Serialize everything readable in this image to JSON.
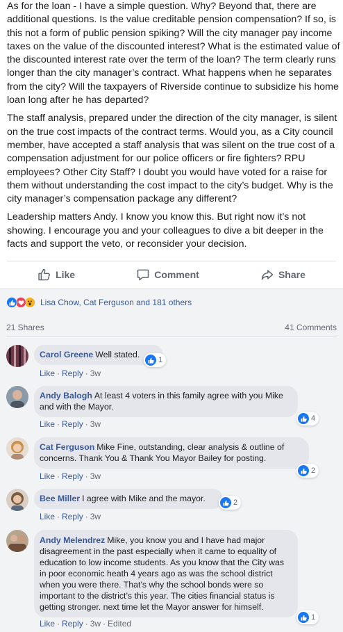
{
  "post": {
    "paragraphs": [
      "As for the loan - I have a simple question. Why? Beyond that, there are additional questions. Is the value creditable pension compensation? If so, is this not a form of public pension spiking? Will the city manager pay income taxes on the value of the discounted interest? What is the estimated value of the discounted interest rate over the term of the loan? The term clearly runs longer than the city manager’s contract. What happens when he separates from the city? Will the taxpayers of Riverside continue to subsidize his home loan long after he has departed?",
      "The staff analysis, prepared under the direction of the city manager, is silent on the true cost impacts of the contract terms. Would you, as a City council member, have accepted a staff analysis that was silent on the true cost of a compensation adjustment for our police officers or fire fighters? RPU employees? Other City Staff? I doubt you would have voted for a raise for them without understanding the cost impact to the city’s budget. Why is the city manager’s compensation package any different?",
      "Leadership matters Andy. I know you know this. But right now it’s not showing. I encourage you and your colleagues to dive a bit deeper in the facts and support the veto, or reconsider your decision."
    ]
  },
  "actions": {
    "like": "Like",
    "comment": "Comment",
    "share": "Share"
  },
  "reactions": {
    "names": "Lisa Chow, Cat Ferguson and 181 others",
    "icons": [
      "like-icon",
      "love-icon",
      "wow-icon"
    ]
  },
  "counts": {
    "shares": "21 Shares",
    "comments": "41 Comments"
  },
  "comments": [
    {
      "author": "Carol Greene",
      "text": "Well stated.",
      "like_label": "Like",
      "reply_label": "Reply",
      "time": "3w",
      "reactions": "1",
      "edited": ""
    },
    {
      "author": "Andy Balogh",
      "text": "At least 4 voters in this family agree with you Mike and with the Mayor.",
      "like_label": "Like",
      "reply_label": "Reply",
      "time": "3w",
      "reactions": "4",
      "edited": ""
    },
    {
      "author": "Cat Ferguson",
      "text": "Mike Fine, outstanding, clear analysis & outline of concerns. Thank You & Thank You Mayor Bailey for posting.",
      "like_label": "Like",
      "reply_label": "Reply",
      "time": "3w",
      "reactions": "2",
      "edited": ""
    },
    {
      "author": "Bee Miller",
      "text": "I agree with Mike and the mayor.",
      "like_label": "Like",
      "reply_label": "Reply",
      "time": "3w",
      "reactions": "2",
      "edited": ""
    },
    {
      "author": "Andy Melendrez",
      "text": "Mike, you know you and I have had major disagreement in the past especially when it came to equality of education to low income students. As you know that the City was in poor economic heath 4 years ago as was the school district when you were there. That’s why the school bonds were so important to the district’s this year. The cities financial status is getting stronger. next time let the Mayor answer for himself.",
      "like_label": "Like",
      "reply_label": "Reply",
      "time": "3w",
      "reactions": "1",
      "edited": "Edited"
    }
  ],
  "colors": {
    "link": "#385898",
    "like_blue": "#1877f2",
    "love_red": "#f33e58",
    "wow_yellow": "#f7b125",
    "bubble_bg": "#e4e6eb",
    "gray_bg": "#f2f3f5"
  }
}
